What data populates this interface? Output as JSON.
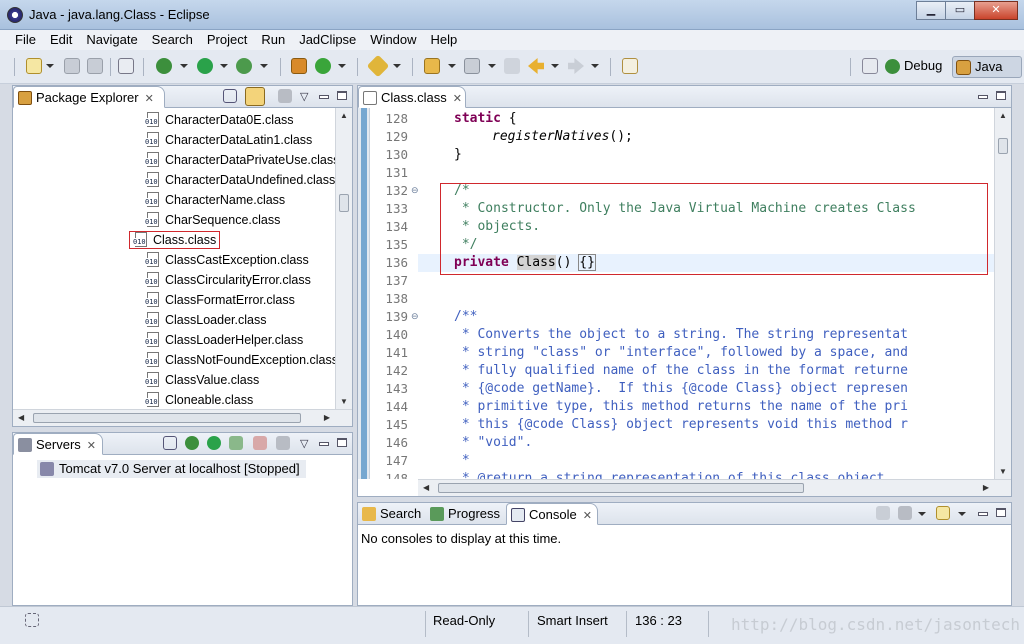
{
  "window": {
    "title": "Java - java.lang.Class - Eclipse",
    "min": "▁",
    "max": "▭",
    "close": "✕"
  },
  "menu": [
    "File",
    "Edit",
    "Navigate",
    "Search",
    "Project",
    "Run",
    "JadClipse",
    "Window",
    "Help"
  ],
  "perspectives": {
    "debug": "Debug",
    "java": "Java"
  },
  "package_explorer": {
    "tab": "Package Explorer",
    "items": [
      "CharacterData0E.class",
      "CharacterDataLatin1.class",
      "CharacterDataPrivateUse.class",
      "CharacterDataUndefined.class",
      "CharacterName.class",
      "CharSequence.class",
      "Class.class",
      "ClassCastException.class",
      "ClassCircularityError.class",
      "ClassFormatError.class",
      "ClassLoader.class",
      "ClassLoaderHelper.class",
      "ClassNotFoundException.class",
      "ClassValue.class",
      "Cloneable.class"
    ],
    "selected_index": 6
  },
  "servers": {
    "tab": "Servers",
    "entry": "Tomcat v7.0 Server at localhost  [Stopped]"
  },
  "editor": {
    "tab": "Class.class",
    "line_numbers": [
      "128",
      "129",
      "130",
      "131",
      "132",
      "133",
      "134",
      "135",
      "136",
      "137",
      "138",
      "139",
      "140",
      "141",
      "142",
      "143",
      "144",
      "145",
      "146",
      "147",
      "148"
    ],
    "lines": {
      "l128_kw": "static",
      "l128_rest": " {",
      "l129": "registerNatives",
      "l129_rest": "();",
      "l130": "}",
      "l132": "/*",
      "l133": " * Constructor. Only the Java Virtual Machine creates Class",
      "l134": " * objects.",
      "l135": " */",
      "l136_kw": "private",
      "l136_cls": "Class",
      "l136_rest": "() ",
      "l136_brace": "{}",
      "l139": "/**",
      "l140": " * Converts the object to a string. The string representat",
      "l141": " * string \"class\" or \"interface\", followed by a space, and",
      "l142": " * fully qualified name of the class in the format returne",
      "l143": " * {@code getName}.  If this {@code Class} object represen",
      "l144": " * primitive type, this method returns the name of the pri",
      "l145": " * this {@code Class} object represents void this method r",
      "l146": " * \"void\".",
      "l147": " *",
      "l148": " * @return a string representation of this class object."
    }
  },
  "bottom": {
    "tabs": {
      "search": "Search",
      "progress": "Progress",
      "console": "Console"
    },
    "console_message": "No consoles to display at this time."
  },
  "status": {
    "mode": "Read-Only",
    "insert": "Smart Insert",
    "position": "136 : 23"
  },
  "watermark": "http://blog.csdn.net/jasontech",
  "colors": {
    "keyword": "#7f0055",
    "comment": "#3f7f5f",
    "javadoc": "#3f5fbf",
    "highlight_box": "#d0282d"
  }
}
